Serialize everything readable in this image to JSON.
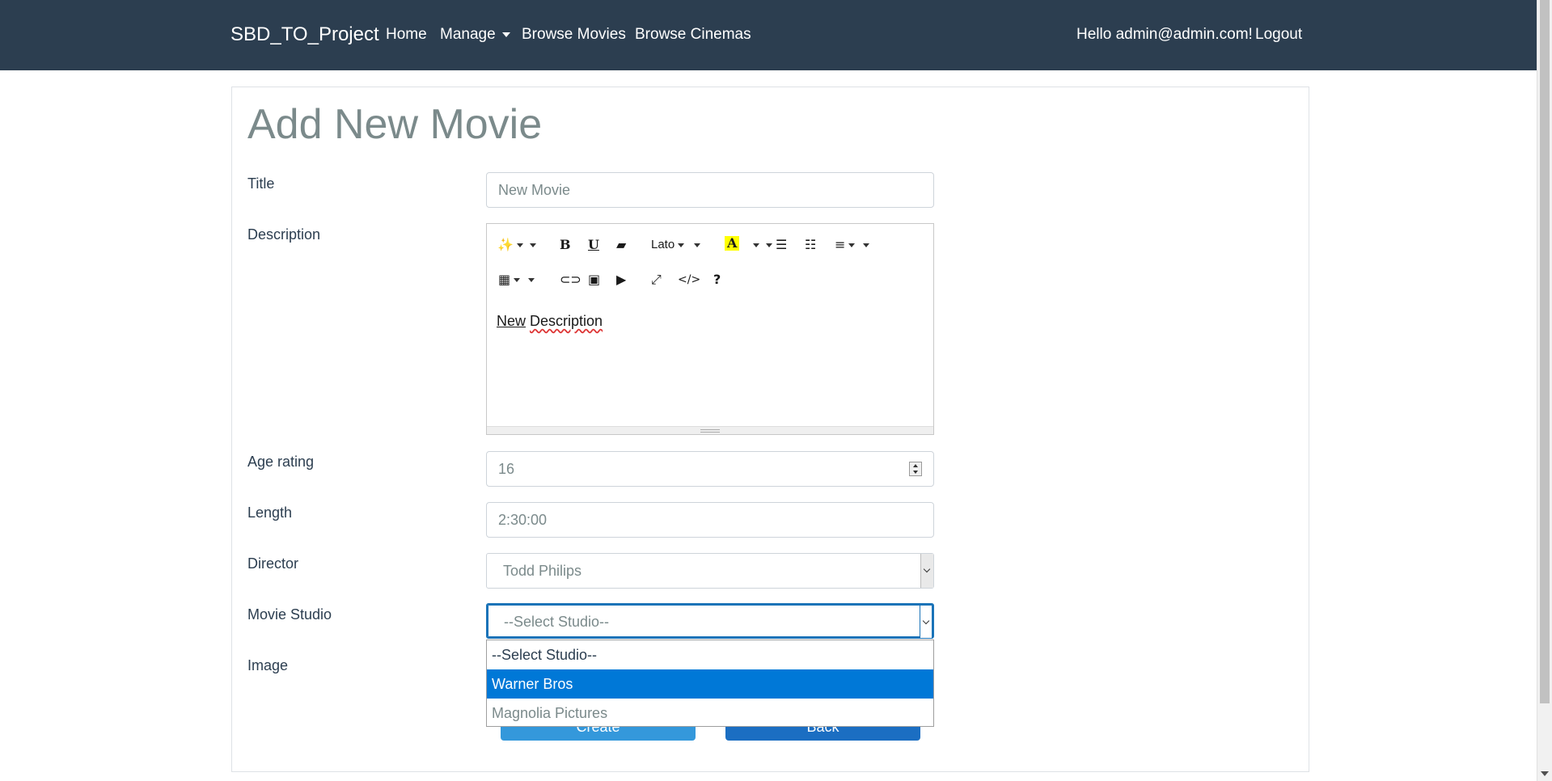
{
  "navbar": {
    "brand": "SBD_TO_Project",
    "links": [
      "Home",
      "Manage",
      "Browse Movies",
      "Browse Cinemas"
    ],
    "greeting": "Hello admin@admin.com!",
    "logout": "Logout"
  },
  "page": {
    "title": "Add New Movie"
  },
  "form": {
    "title_label": "Title",
    "title_value": "New Movie",
    "description_label": "Description",
    "description_value": [
      "New",
      "Description"
    ],
    "editor_font": "Lato",
    "age_label": "Age rating",
    "age_value": "16",
    "length_label": "Length",
    "length_value": "2:30:00",
    "director_label": "Director",
    "director_value": "Todd Philips",
    "studio_label": "Movie Studio",
    "studio_value": "--Select Studio--",
    "image_label": "Image",
    "studio_options": [
      "--Select Studio--",
      "Warner Bros",
      "Magnolia Pictures"
    ],
    "create_button": "Create",
    "back_button": "Back"
  },
  "colors": {
    "navbar": "#2c3e50",
    "accent": "#0078d7",
    "create": "#3498db",
    "back": "#1b6ec2"
  }
}
